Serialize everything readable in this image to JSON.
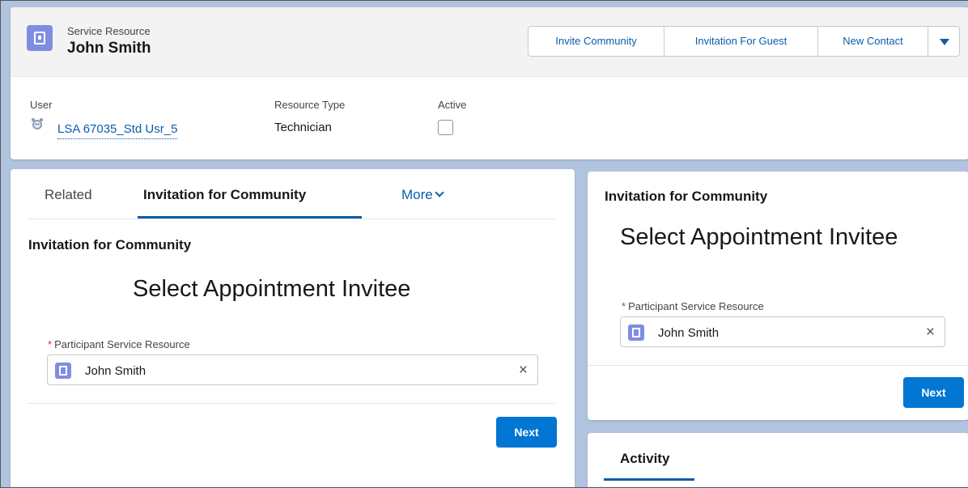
{
  "header": {
    "object_label": "Service Resource",
    "record_name": "John Smith",
    "actions": [
      "Invite Community",
      "Invitation For Guest",
      "New Contact"
    ],
    "fields": {
      "user_label": "User",
      "user_value": "LSA 67035_Std Usr_5",
      "resource_type_label": "Resource Type",
      "resource_type_value": "Technician",
      "active_label": "Active",
      "active_checked": false
    }
  },
  "left_panel": {
    "tabs": [
      "Related",
      "Invitation for Community",
      "More"
    ],
    "active_tab": "Invitation for Community",
    "section_title": "Invitation for Community",
    "heading": "Select Appointment Invitee",
    "field_label": "Participant Service Resource",
    "field_value": "John Smith",
    "next_label": "Next"
  },
  "right_panel": {
    "section_title": "Invitation for Community",
    "heading": "Select Appointment Invitee",
    "field_label": "Participant Service Resource",
    "field_value": "John Smith",
    "next_label": "Next"
  },
  "activity": {
    "title": "Activity"
  },
  "colors": {
    "brand_blue": "#0176d3",
    "link_blue": "#0b5cab",
    "record_icon": "#7f8de1",
    "page_background": "#b0c4df"
  }
}
